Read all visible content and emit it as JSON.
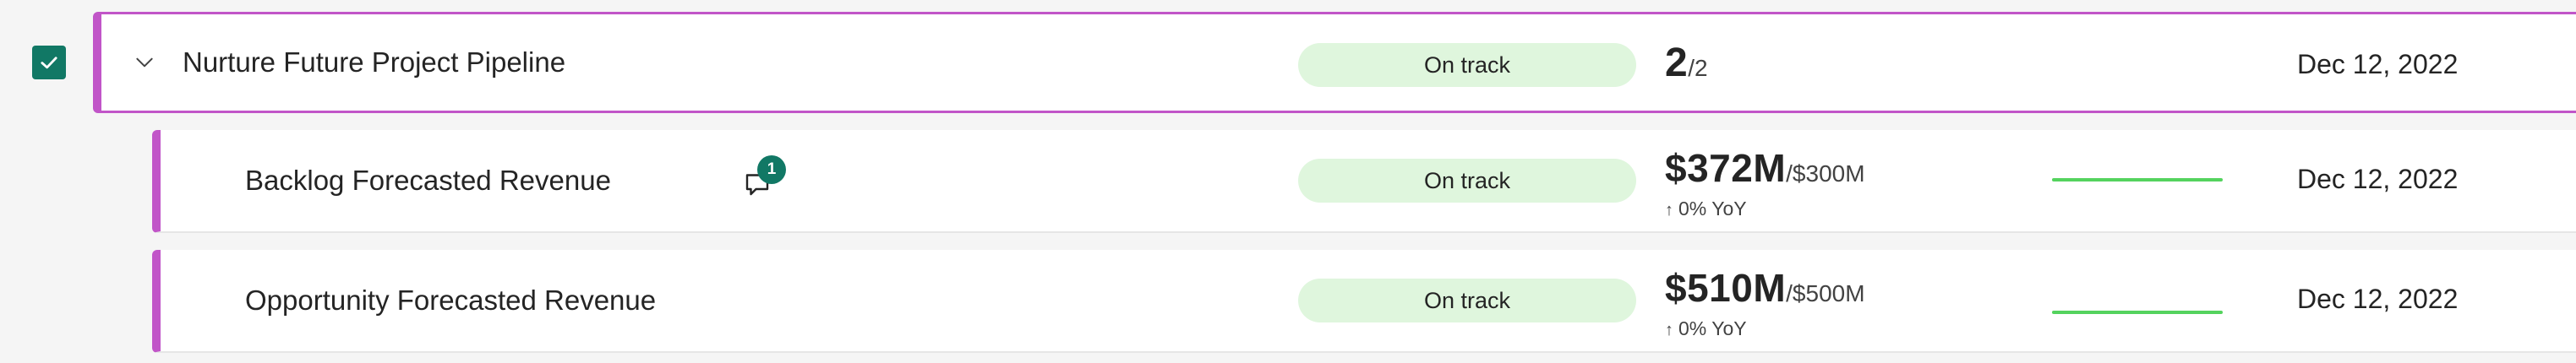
{
  "colors": {
    "accent": "#c155c8",
    "status_bg": "#dff6dd",
    "trend": "#54d35e",
    "badge": "#117865",
    "checkbox": "#117865"
  },
  "icons": {
    "checkbox": "checkmark-icon",
    "expand": "chevron-down-icon",
    "comment": "comment-icon",
    "change": "arrow-up-icon"
  },
  "parent": {
    "name": "Nurture Future Project Pipeline",
    "checked": true,
    "status": "On track",
    "value": "2",
    "target": "/2",
    "due": "Dec 12, 2022"
  },
  "children": [
    {
      "name": "Backlog Forecasted Revenue",
      "comment_count": "1",
      "status": "On track",
      "value": "$372M",
      "target": "/$300M",
      "change": "0% YoY",
      "due": "Dec 12, 2022"
    },
    {
      "name": "Opportunity Forecasted Revenue",
      "status": "On track",
      "value": "$510M",
      "target": "/$500M",
      "change": "0% YoY",
      "due": "Dec 12, 2022"
    }
  ]
}
